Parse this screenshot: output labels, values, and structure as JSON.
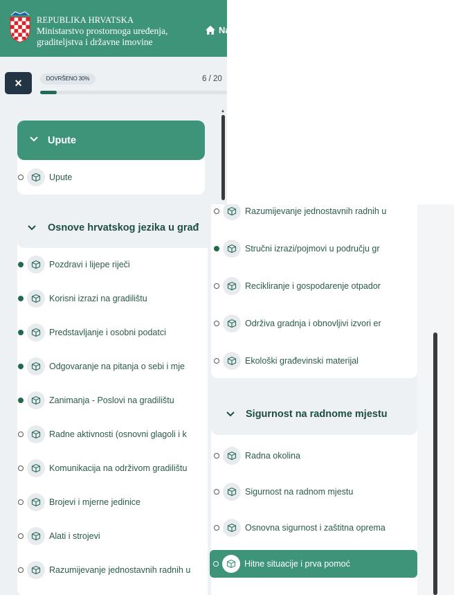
{
  "header": {
    "title_line1": "REPUBLIKA HRVATSKA",
    "title_line2": "Ministarstvo prostornoga uređenja,",
    "title_line3": "graditeljstva i državne imovine",
    "home_label": "Naslovnica",
    "icons": {
      "coat_of_arms": "coat-of-arms-icon",
      "home": "home-icon"
    }
  },
  "toolbar": {
    "close_label": "×"
  },
  "progress": {
    "label": "DOVRŠENO 30%",
    "percent": 30,
    "count": "6 / 20"
  },
  "left": {
    "sections": [
      {
        "title": "Upute",
        "style": "green",
        "items": [
          {
            "label": "Upute",
            "done": false
          }
        ]
      },
      {
        "title": "Osnove hrvatskog jezika u građ",
        "style": "light",
        "items": [
          {
            "label": "Pozdravi i lijepe riječi",
            "done": true
          },
          {
            "label": "Korisni izrazi na gradilištu",
            "done": true
          },
          {
            "label": "Predstavljanje i osobni podatci",
            "done": true
          },
          {
            "label": "Odgovaranje na pitanja o sebi i mje",
            "done": true
          },
          {
            "label": "Zanimanja - Poslovi na gradilištu",
            "done": true
          },
          {
            "label": "Radne aktivnosti (osnovni glagoli i k",
            "done": false
          },
          {
            "label": "Komunikacija na održivom gradilištu",
            "done": false
          },
          {
            "label": "Brojevi i mjerne jedinice",
            "done": false
          },
          {
            "label": "Alati i strojevi",
            "done": false
          },
          {
            "label": "Razumijevanje jednostavnih radnih u",
            "done": false
          }
        ]
      }
    ]
  },
  "right": {
    "top_items": [
      {
        "label": "Razumijevanje jednostavnih radnih u",
        "done": false
      },
      {
        "label": "Stručni izrazi/pojmovi u području gr",
        "done": true
      },
      {
        "label": "Recikliranje i gospodarenje otpador",
        "done": false
      },
      {
        "label": "Održiva gradnja i obnovljivi izvori er",
        "done": false
      },
      {
        "label": "Ekološki građevinski materijal",
        "done": false
      }
    ],
    "section": {
      "title": "Sigurnost na radnome mjestu",
      "items": [
        {
          "label": "Radna okolina",
          "done": false
        },
        {
          "label": "Sigurnost na radnom mjestu",
          "done": false
        },
        {
          "label": "Osnovna sigurnost i zaštitna oprema",
          "done": false
        },
        {
          "label": "Hitne situacije i prva pomoć",
          "done": false,
          "active": true
        }
      ]
    }
  },
  "item_icon": "box-icon",
  "chevron_icon": "chevron-down-icon",
  "colors": {
    "brand_green": "#3e9478",
    "dark_green": "#226c55",
    "close_bg": "#233444"
  }
}
